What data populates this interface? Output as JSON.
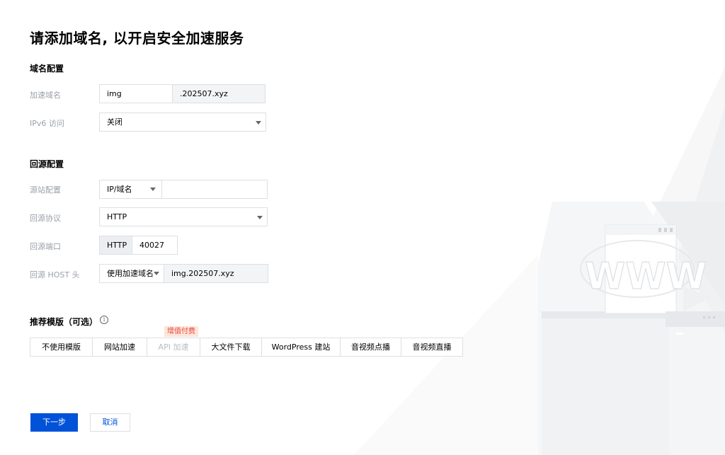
{
  "page": {
    "title": "请添加域名, 以开启安全加速服务"
  },
  "domain_config": {
    "section_title": "域名配置",
    "accel_domain": {
      "label": "加速域名",
      "prefix_value": "img",
      "suffix_value": ".202507.xyz"
    },
    "ipv6": {
      "label": "IPv6 访问",
      "value": "关闭"
    }
  },
  "origin_config": {
    "section_title": "回源配置",
    "origin": {
      "label": "源站配置",
      "type_value": "IP/域名",
      "address_value": ""
    },
    "protocol": {
      "label": "回源协议",
      "value": "HTTP"
    },
    "port": {
      "label": "回源端口",
      "prefix": "HTTP",
      "value": "40027"
    },
    "host": {
      "label": "回源 HOST 头",
      "type_value": "使用加速域名",
      "value": "img.202507.xyz"
    }
  },
  "templates": {
    "title": "推荐模版（可选）",
    "info_glyph": "i",
    "badge": "增值付费",
    "tabs": [
      "不使用模版",
      "网站加速",
      "API 加速",
      "大文件下载",
      "WordPress 建站",
      "音视频点播",
      "音视频直播"
    ]
  },
  "actions": {
    "next_label": "下一步",
    "cancel_label": "取消"
  },
  "illustration": {
    "text": "WWW"
  }
}
